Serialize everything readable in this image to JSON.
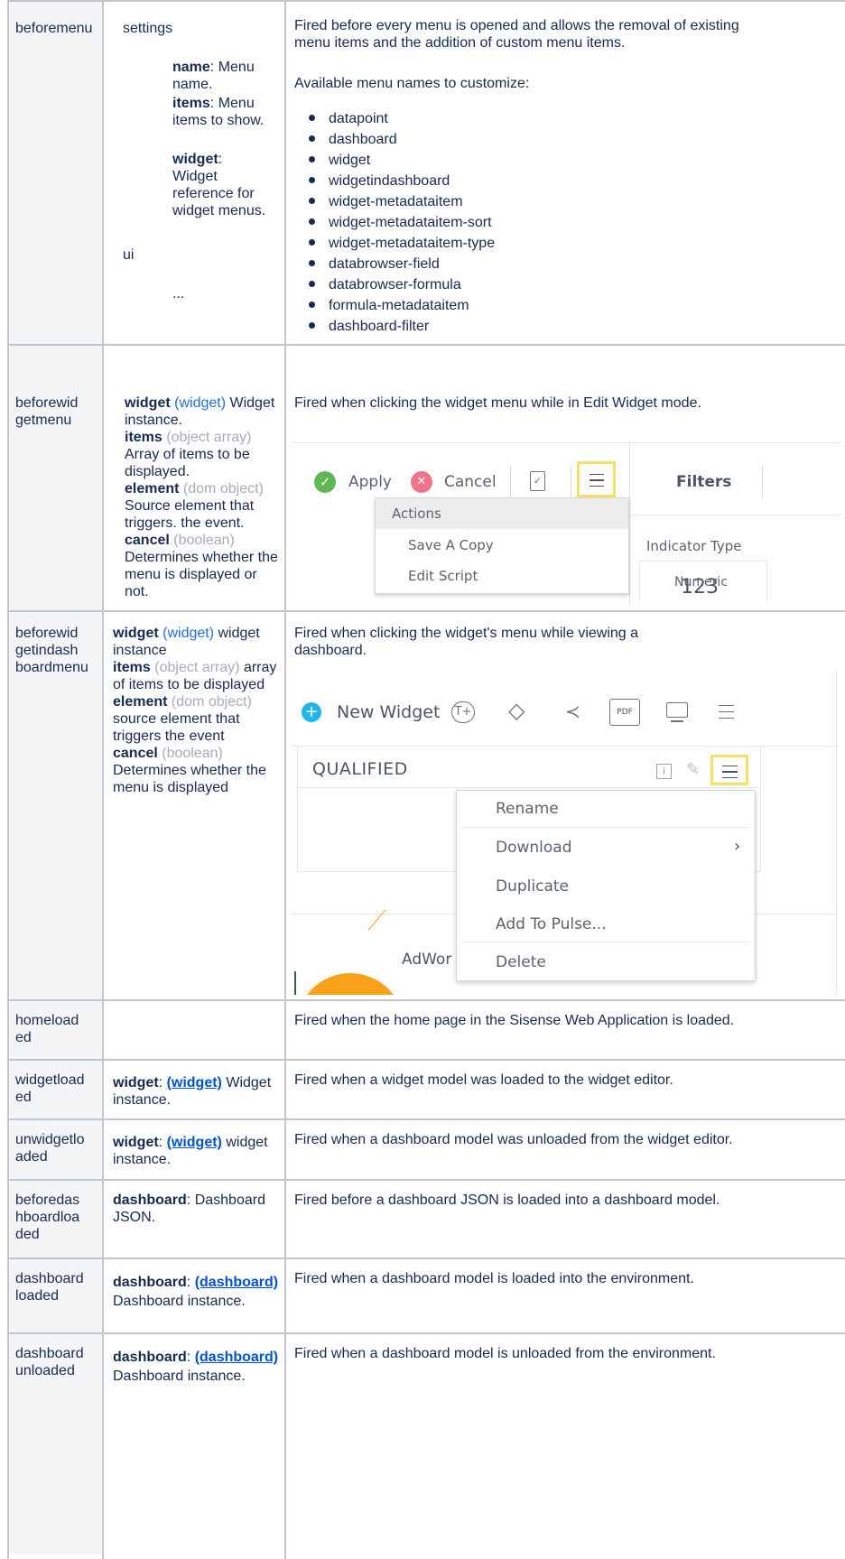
{
  "rows": {
    "beforemenu": {
      "name": "beforemenu",
      "param_settings": "settings",
      "param_name_label": "name",
      "param_name_desc": ": Menu name.",
      "param_items_label": "items",
      "param_items_desc": ": Menu items to show.",
      "param_widget_label": "widget",
      "param_widget_desc": ": Widget reference for widget menus.",
      "param_ui": "ui",
      "param_ellipsis": "...",
      "desc": "Fired before every menu is opened and allows the removal of existing menu items and the addition of custom menu items.",
      "available": "Available menu names to customize:",
      "menu_names": [
        "datapoint",
        "dashboard",
        "widget",
        "widgetindashboard",
        "widget-metadataitem",
        "widget-metadataitem-sort",
        "widget-metadataitem-type",
        "databrowser-field",
        "databrowser-formula",
        "formula-metadataitem",
        "dashboard-filter"
      ]
    },
    "beforewidgetmenu": {
      "name_1": "beforewid",
      "name_2": "getmenu",
      "desc": "Fired when clicking the widget menu while in Edit Widget mode.",
      "p_widget": "widget",
      "p_widget_type": "(widget)",
      "p_widget_desc": "Widget instance.",
      "p_items": "items",
      "p_items_type": "(object array)",
      "p_items_desc": "Array of items to be displayed.",
      "p_element": "element",
      "p_element_type": "(dom object)",
      "p_element_desc": "Source element that triggers. the event.",
      "p_cancel": "cancel",
      "p_cancel_type": "(boolean)",
      "p_cancel_desc": "Determines whether the menu is displayed or not.",
      "shot": {
        "apply": "Apply",
        "cancel": "Cancel",
        "filters": "Filters",
        "menu_header": "Actions",
        "menu_items": [
          "Save A Copy",
          "Edit Script"
        ],
        "indicator_type": "Indicator Type",
        "number": "123",
        "numeric": "Numeric"
      }
    },
    "beforewidgetindashboardmenu": {
      "name_1": "beforewid",
      "name_2": "getindash",
      "name_3": "boardmenu",
      "desc": "Fired when clicking the widget's menu while viewing a dashboard.",
      "p_widget": "widget",
      "p_widget_type": "(widget)",
      "p_widget_desc": "widget instance",
      "p_items": "items",
      "p_items_type": "(object array)",
      "p_items_desc": "array of items to be displayed",
      "p_element": "element",
      "p_element_type": "(dom object)",
      "p_element_desc": "source element that triggers the event",
      "p_cancel": "cancel",
      "p_cancel_type": "(boolean)",
      "p_cancel_desc": "Determines whether the menu is displayed",
      "shot": {
        "new_widget": "New Widget",
        "pdf": "PDF",
        "widget_title": "QUALIFIED",
        "menu_items": [
          "Rename",
          "Download",
          "Duplicate",
          "Add To Pulse...",
          "Delete"
        ],
        "chart_label": "AdWor"
      }
    },
    "homeloaded": {
      "name_1": "homeload",
      "name_2": "ed",
      "desc": "Fired when the home page in the Sisense Web Application is loaded."
    },
    "widgetloaded": {
      "name_1": "widgetload",
      "name_2": "ed",
      "p_label": "widget",
      "p_sep": ": ",
      "p_link": "(widget)",
      "p_desc": "Widget instance.",
      "desc": "Fired when a widget model was loaded to the widget editor."
    },
    "unwidgetloaded": {
      "name_1": "unwidgetlo",
      "name_2": "aded",
      "p_label": "widget",
      "p_sep": ": ",
      "p_link": "(widget)",
      "p_desc": "widget instance.",
      "desc": "Fired when a dashboard model was unloaded from the widget editor."
    },
    "beforedashboardloaded": {
      "name_1": "beforedas",
      "name_2": "hboardloa",
      "name_3": "ded",
      "p_label": "dashboard",
      "p_desc": ": Dashboard JSON.",
      "desc": "Fired before a dashboard JSON is loaded into a dashboard model."
    },
    "dashboardloaded": {
      "name_1": "dashboard",
      "name_2": "loaded",
      "p_label": "dashboard",
      "p_sep": ": ",
      "p_link": "(dashboard)",
      "p_desc": "Dashboard instance.",
      "desc": "Fired when a dashboard model is loaded into the environment."
    },
    "dashboardunloaded": {
      "name_1": "dashboard",
      "name_2": "unloaded",
      "p_label": "dashboard",
      "p_sep": ": ",
      "p_link": "(dashboard)",
      "p_desc": "Dashboard instance.",
      "desc": "Fired when a dashboard model is unloaded from the environment."
    }
  },
  "colors": {
    "border": "#c1c7d0",
    "header_shade": "#f4f5f7",
    "link": "#0052cc",
    "type_blue": "#1f6ed4",
    "muted": "#a5adba",
    "highlight": "#f5e06a",
    "check_green": "#5fb854",
    "cancel_pink": "#f0738c",
    "new_widget_blue": "#1fb5e6",
    "chart_orange": "#f8a21a"
  }
}
